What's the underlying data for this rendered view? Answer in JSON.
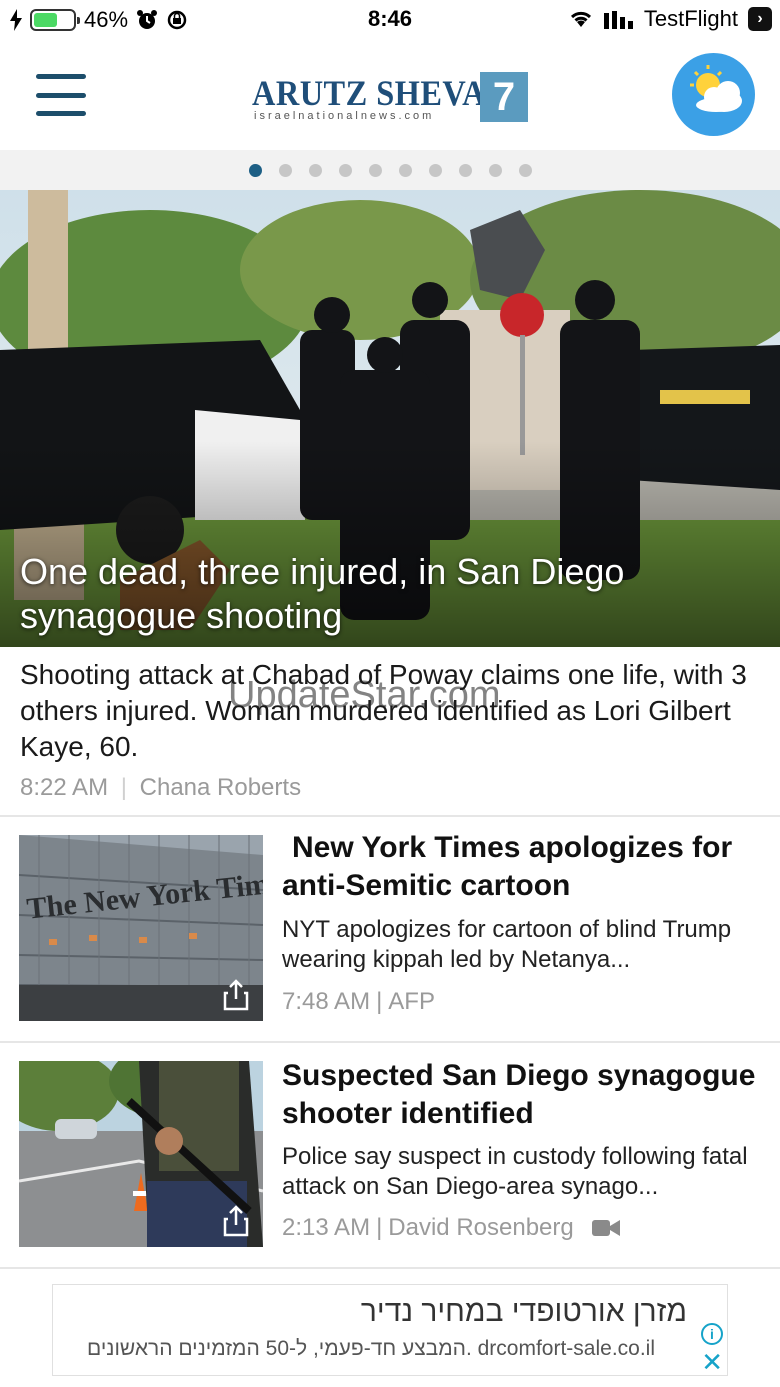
{
  "status_bar": {
    "battery_percent": "46%",
    "time": "8:46",
    "carrier": "TestFlight"
  },
  "header": {
    "logo_main": "ARUTZ SHEVA",
    "logo_number": "7",
    "logo_url": "israelnationalnews.com"
  },
  "carousel": {
    "total_pages": 10,
    "active_page": 1
  },
  "hero": {
    "title": "One dead, three injured, in San Diego synagogue shooting",
    "summary": "Shooting attack at Chabad of Poway claims one life, with 3 others injured. Woman murdered identified as Lori Gilbert Kaye, 60.",
    "time": "8:22 AM",
    "separator": "|",
    "author": "Chana Roberts"
  },
  "watermark": "UpdateStar.com",
  "articles": [
    {
      "title": "New York Times apologizes for anti-Semitic cartoon",
      "summary": "NYT apologizes for cartoon of blind Trump wearing kippah led by Netanya...",
      "time": "7:48 AM",
      "separator": "|",
      "source": "AFP",
      "has_video": false
    },
    {
      "title": "Suspected San Diego synagogue shooter identified",
      "summary": "Police say suspect in custody following fatal attack on San Diego-area synago...",
      "time": "2:13 AM",
      "separator": "|",
      "source": "David Rosenberg",
      "has_video": true
    }
  ],
  "ad": {
    "title": "מזרן אורטופדי במחיר נדיר",
    "line": "המבצע חד-פעמי, ל-50 המזמינים הראשונים. drcomfort-sale.co.il",
    "info_icon": "info-icon",
    "close_icon": "close-icon"
  },
  "colors": {
    "brand_blue": "#1f4e79",
    "dot_active": "#1d5f85",
    "dot_inactive": "#c6c6c6",
    "meta_gray": "#9a9a9a",
    "ad_accent": "#16a3c9"
  }
}
